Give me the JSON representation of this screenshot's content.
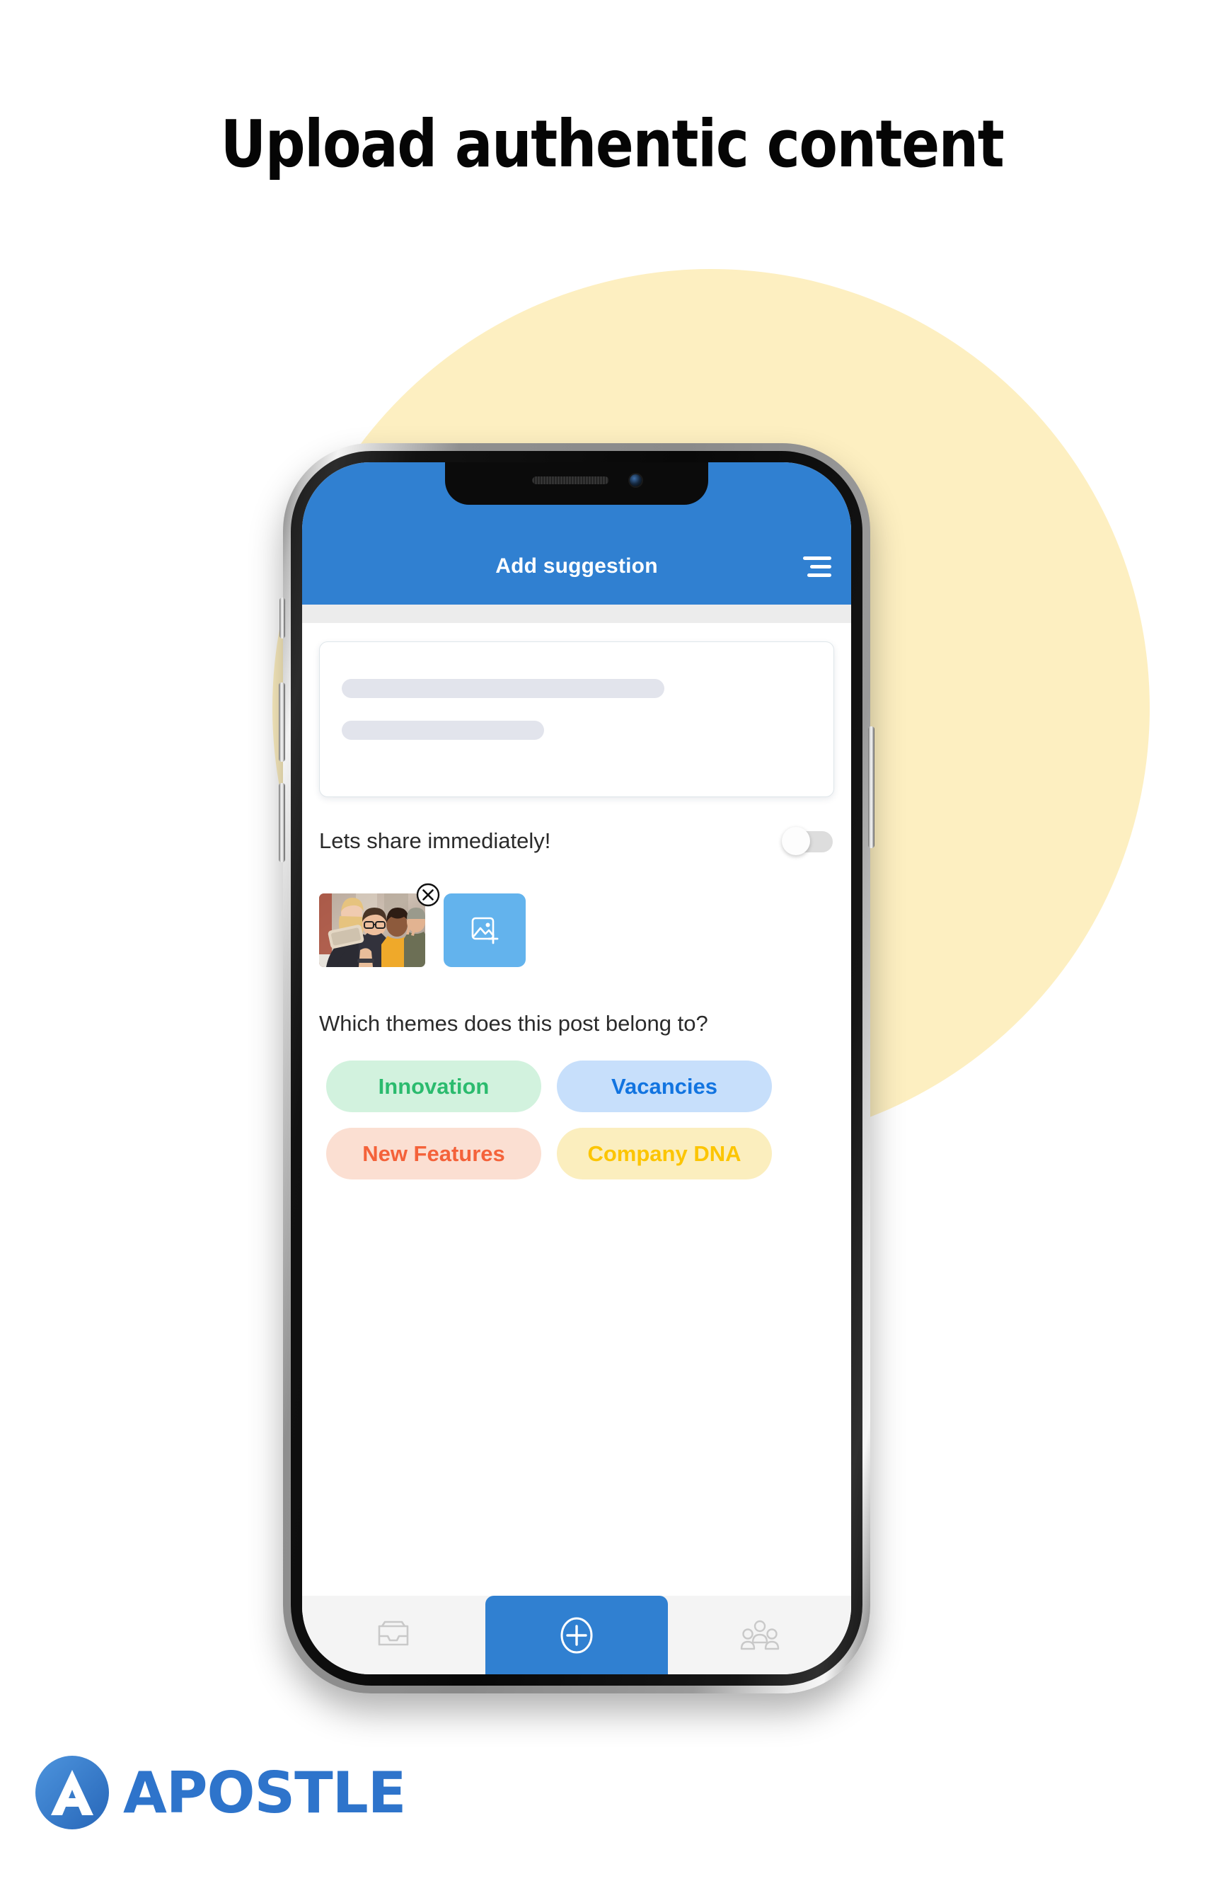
{
  "headline": "Upload authentic content",
  "colors": {
    "brand_blue": "#3080D1",
    "light_blue": "#63B3ED",
    "circle_yellow": "#FDEFC1",
    "logo_blue": "#2E74CB",
    "skeleton_gray": "#E2E4EC",
    "nav_bar": "#f4f4f4"
  },
  "phone": {
    "app": {
      "header": {
        "title": "Add suggestion",
        "menu_icon": "hamburger-menu-icon"
      },
      "compose": {
        "placeholder_lines": 2
      },
      "share_toggle": {
        "label": "Lets share immediately!",
        "state": "off"
      },
      "media": {
        "thumbnail_alt": "group-selfie-photo",
        "remove_icon": "close-circle-icon",
        "add_button_icon": "add-image-icon"
      },
      "themes": {
        "question": "Which themes does this post belong to?",
        "tags": [
          {
            "label": "Innovation",
            "bg": "#D2F2DE",
            "fg": "#2BBB6E"
          },
          {
            "label": "Vacancies",
            "bg": "#C7DFFB",
            "fg": "#1274E0"
          },
          {
            "label": "New Features",
            "bg": "#FBDFD2",
            "fg": "#F4623A"
          },
          {
            "label": "Company DNA",
            "bg": "#FBEEBE",
            "fg": "#FCC502"
          }
        ]
      },
      "bottom_nav": [
        {
          "name": "inbox",
          "icon": "inbox-tray-icon"
        },
        {
          "name": "add",
          "icon": "plus-circle-icon"
        },
        {
          "name": "people",
          "icon": "people-group-icon"
        }
      ]
    }
  },
  "footer": {
    "logo_text": "APOSTLE",
    "logo_mark": "apostle-a-mark-icon"
  }
}
